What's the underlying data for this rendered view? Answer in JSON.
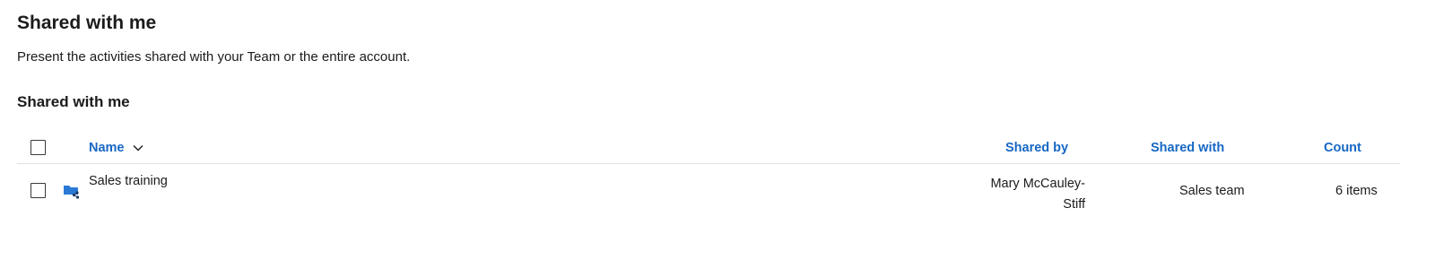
{
  "page": {
    "title": "Shared with me",
    "description": "Present the activities shared with your Team or the entire account."
  },
  "section": {
    "title": "Shared with me"
  },
  "table": {
    "columns": {
      "name": "Name",
      "shared_by": "Shared by",
      "shared_with": "Shared with",
      "count": "Count"
    },
    "sort": {
      "column": "name",
      "icon": "chevron-down-icon"
    },
    "rows": [
      {
        "icon": "shared-folder-icon",
        "name": "Sales training",
        "shared_by": "Mary McCauley-Stiff",
        "shared_with": "Sales team",
        "count": "6 items"
      }
    ]
  },
  "colors": {
    "accent": "#1767c4",
    "folder": "#2a7ad5",
    "text": "#1b1b1b",
    "divider": "#e1e1e1"
  }
}
